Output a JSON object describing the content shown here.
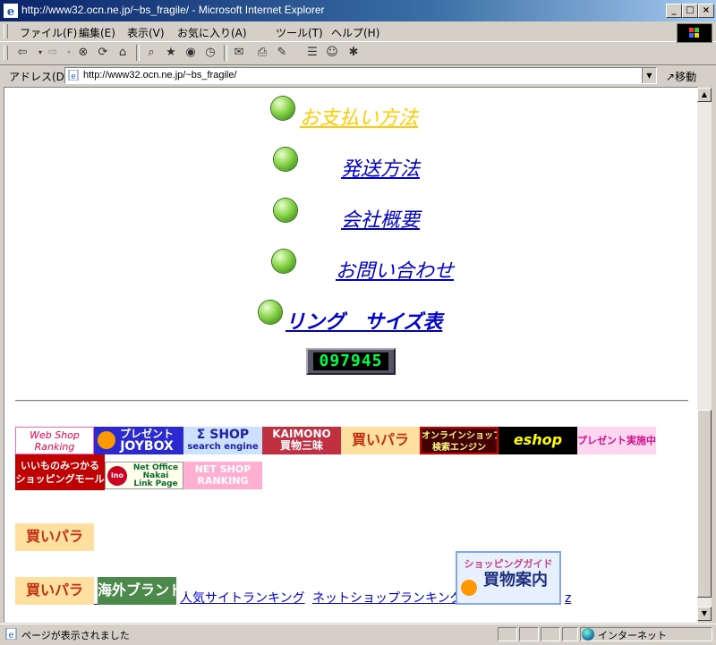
{
  "window": {
    "title": "http://www32.ocn.ne.jp/~bs_fragile/ - Microsoft Internet Explorer",
    "controls": {
      "minimize": "_",
      "maximize": "□",
      "close": "×"
    }
  },
  "menu": [
    "ファイル(F)",
    "編集(E)",
    "表示(V)",
    "お気に入り(A)",
    "ツール(T)",
    "ヘルプ(H)"
  ],
  "toolbar": {
    "back": "⇦",
    "forward": "⇨",
    "stop": "⊗",
    "refresh": "⟳",
    "home": "⌂",
    "search": "⌕",
    "favorites": "★",
    "media": "◉",
    "history": "◷",
    "mail": "✉",
    "print": "⎙",
    "edit": "✎",
    "discuss": "☰",
    "messenger": "☺",
    "research": "✱"
  },
  "address": {
    "label": "アドレス(D)",
    "url": "http://www32.ocn.ne.jp/~bs_fragile/",
    "go_label": "移動",
    "go_icon": "↗"
  },
  "content": {
    "nav_links": [
      {
        "label": "お支払い方法"
      },
      {
        "label": "発送方法"
      },
      {
        "label": "会社概要"
      },
      {
        "label": "お問い合わせ"
      },
      {
        "label": "リング　サイズ表"
      }
    ],
    "counter": "097945",
    "banners": {
      "web_shop_ranking": [
        "Web Shop",
        "Ranking"
      ],
      "joybox": [
        "プレゼント",
        "JOYBOX"
      ],
      "sigma_shop": [
        "Σ SHOP",
        "search engine"
      ],
      "kaimono_zanmai": [
        "KAIMONO",
        "買物三昧"
      ],
      "kaipara": "買いパラ",
      "online_shop": [
        "オンラインショップ",
        "検索エンジン"
      ],
      "eshop": "eshop",
      "present": "プレゼント実施中!",
      "iimono": [
        "いいものみつかる",
        "ショッピングモール"
      ],
      "nakai": {
        "logo": "ino",
        "lines": [
          "Net Office",
          "Nakai",
          "Link Page"
        ]
      },
      "netshop_ranking": [
        "NET SHOP",
        "RANKING"
      ],
      "kaipara2": "買いパラ",
      "kaipara3": "買いパラ",
      "kaigai_brand": "海外ブランド",
      "shopping_guide": [
        "ショッピングガイド",
        "買物案内"
      ]
    },
    "text_links": [
      "人気サイトランキング",
      "ネットショップランキング"
    ],
    "z_link": "z"
  },
  "status": {
    "text": "ページが表示されました",
    "zone": "インターネット"
  }
}
